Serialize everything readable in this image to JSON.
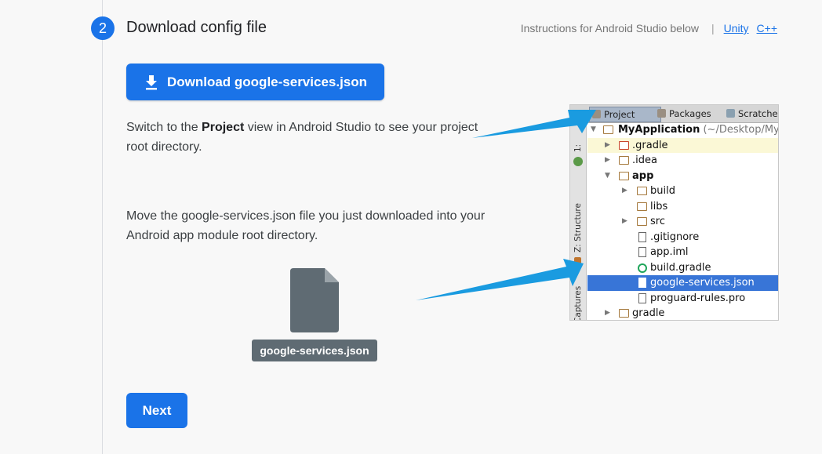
{
  "step": {
    "number": "2",
    "title": "Download config file"
  },
  "header_links": {
    "instructions": "Instructions for Android Studio below",
    "separator": "|",
    "unity": "Unity",
    "cpp": "C++"
  },
  "download_button": {
    "label": "Download google-services.json",
    "icon": "download-icon"
  },
  "instruction_1": {
    "before": "Switch to the ",
    "bold": "Project",
    "after": " view in Android Studio to see your project root directory."
  },
  "instruction_2": {
    "text": "Move the google-services.json file you just downloaded into your Android app module root directory."
  },
  "file_chip": {
    "label": "google-services.json"
  },
  "next_button": {
    "label": "Next"
  },
  "studio": {
    "tabs": [
      "Project",
      "Packages",
      "Scratches"
    ],
    "side_labels": [
      "1:",
      "Z: Structure",
      "Captures"
    ],
    "tree": [
      {
        "label": "MyApplication",
        "suffix": "(~/Desktop/My",
        "bold": true
      },
      {
        "label": ".gradle"
      },
      {
        "label": ".idea"
      },
      {
        "label": "app",
        "bold": true
      },
      {
        "label": "build"
      },
      {
        "label": "libs"
      },
      {
        "label": "src"
      },
      {
        "label": ".gitignore"
      },
      {
        "label": "app.iml"
      },
      {
        "label": "build.gradle"
      },
      {
        "label": "google-services.json"
      },
      {
        "label": "proguard-rules.pro"
      },
      {
        "label": "gradle"
      }
    ]
  },
  "colors": {
    "accent": "#1a73e8",
    "selected_row": "#3875d7",
    "arrow": "#1a9be0"
  }
}
